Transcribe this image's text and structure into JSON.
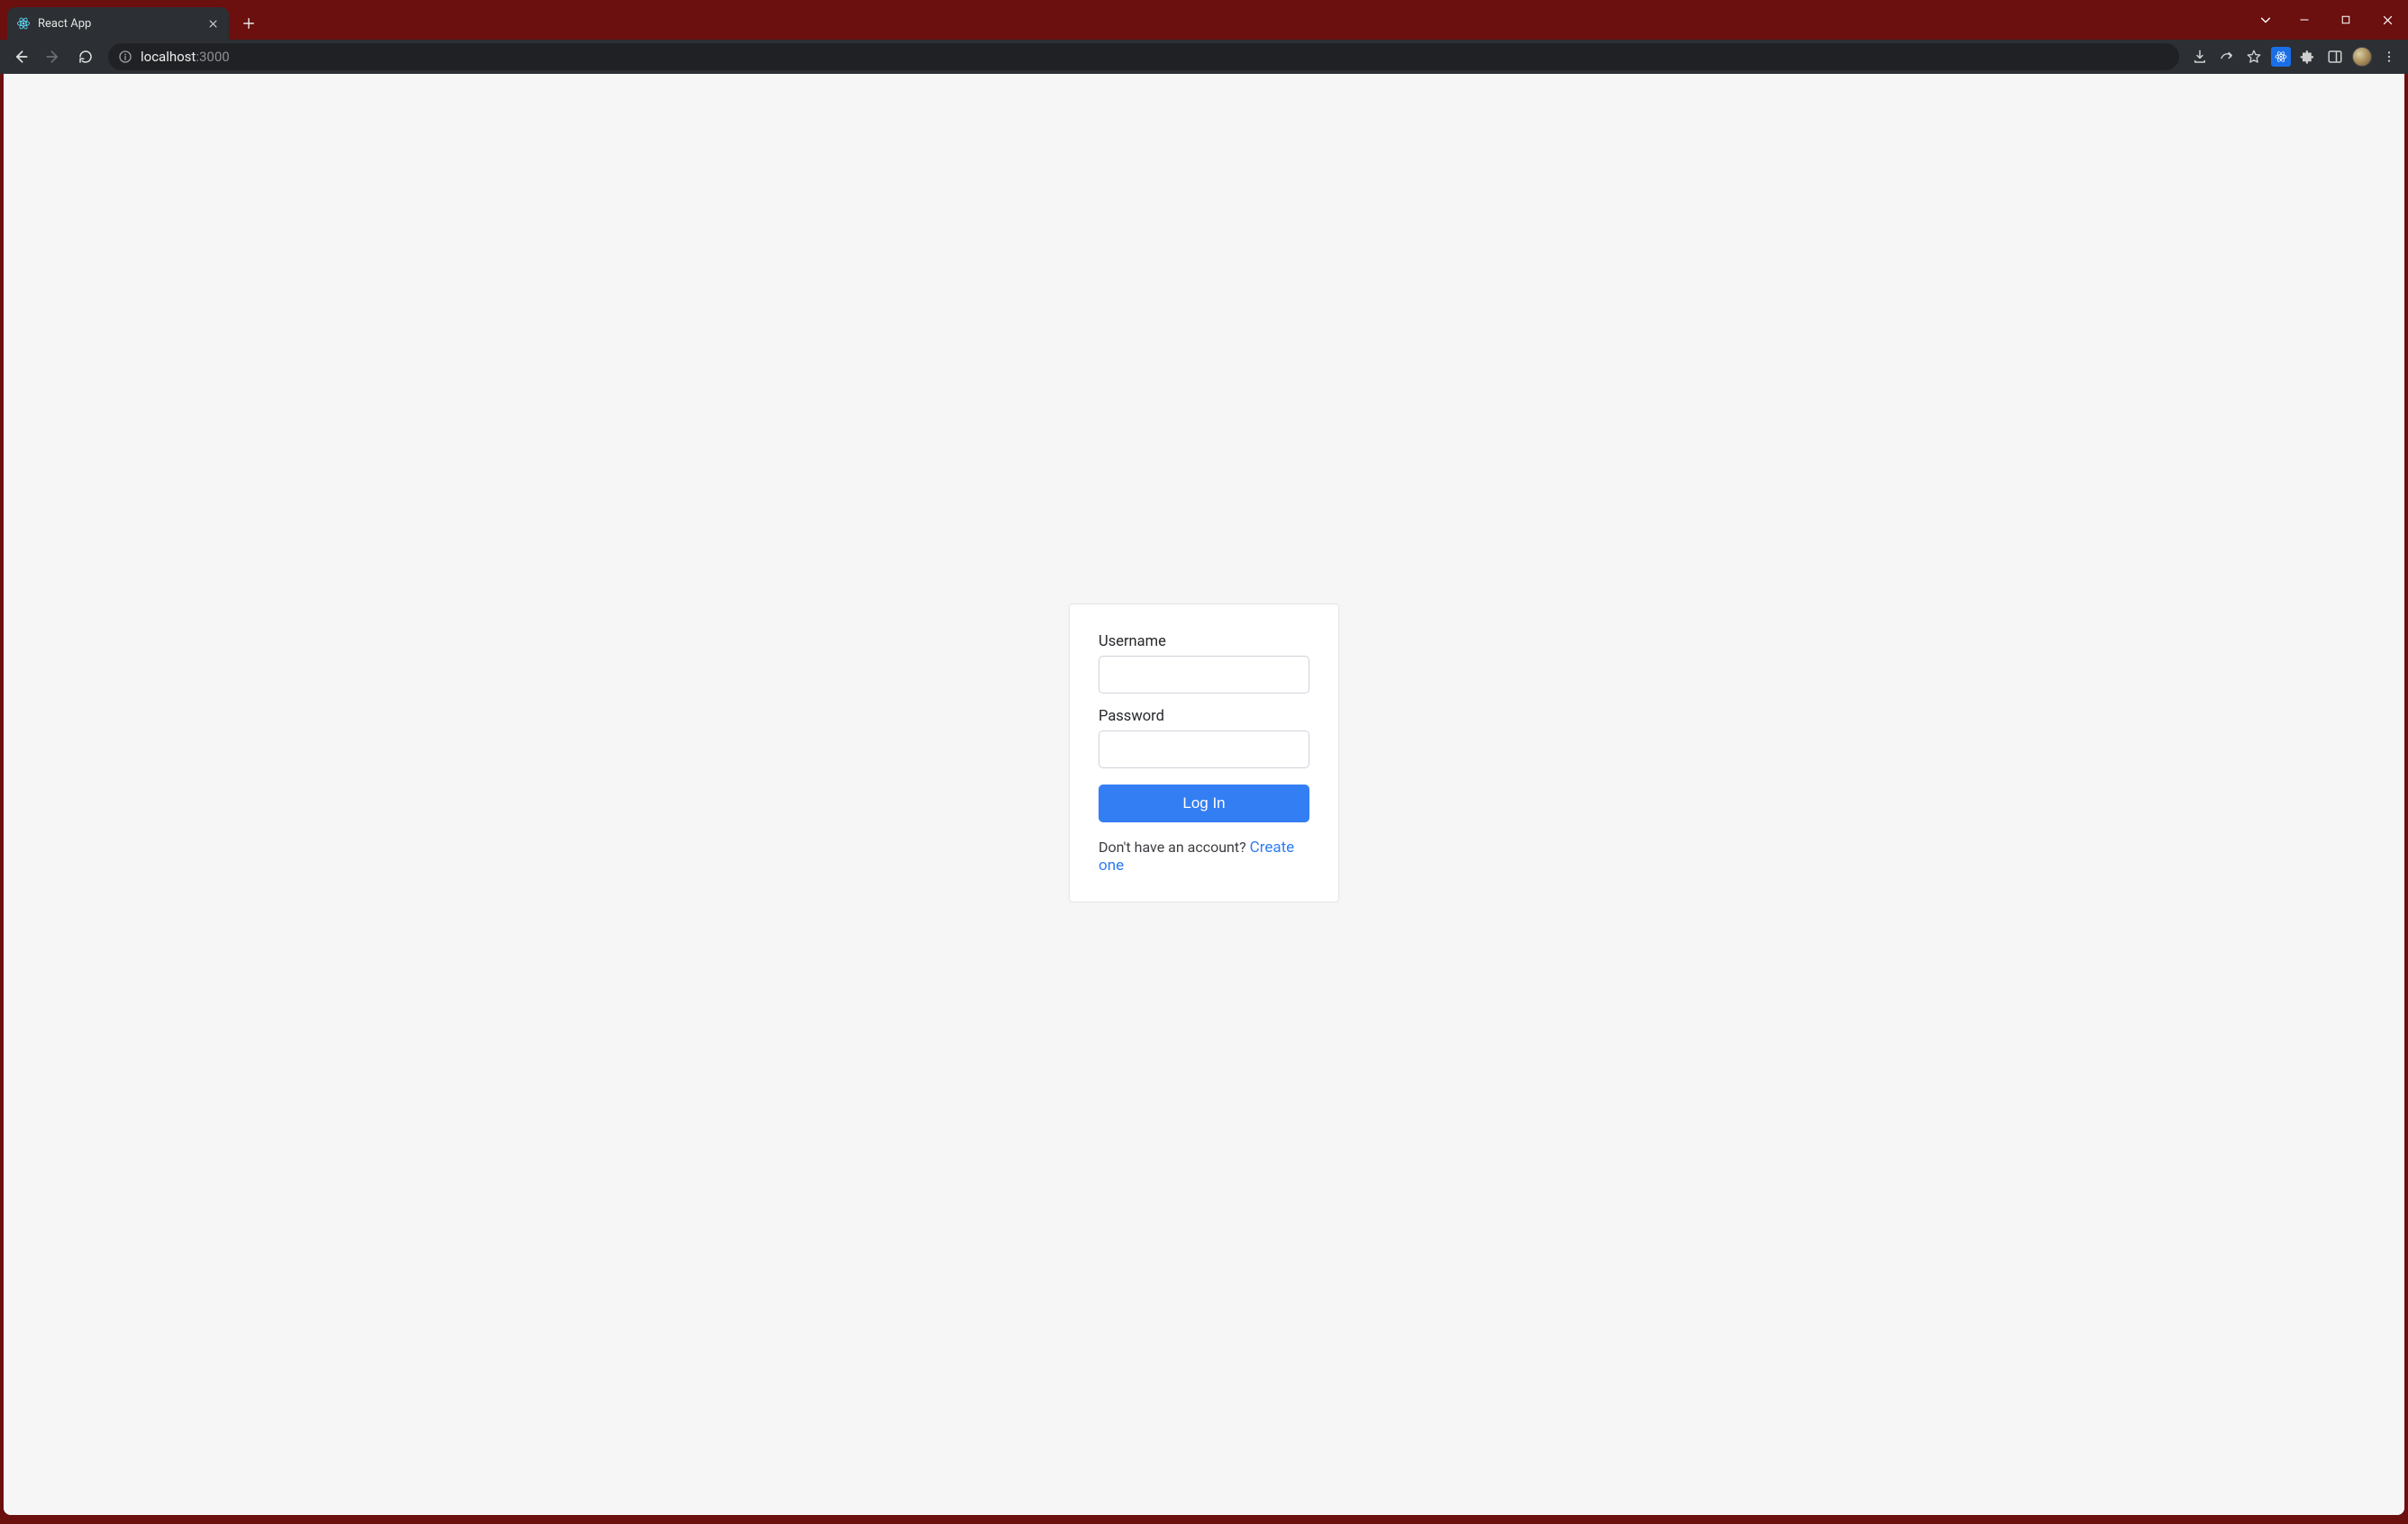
{
  "browser": {
    "tab_title": "React App",
    "url_host": "localhost",
    "url_port": ":3000"
  },
  "login": {
    "username_label": "Username",
    "username_value": "",
    "password_label": "Password",
    "password_value": "",
    "submit_label": "Log In",
    "signup_prompt": "Don't have an account? ",
    "signup_link": "Create one"
  }
}
